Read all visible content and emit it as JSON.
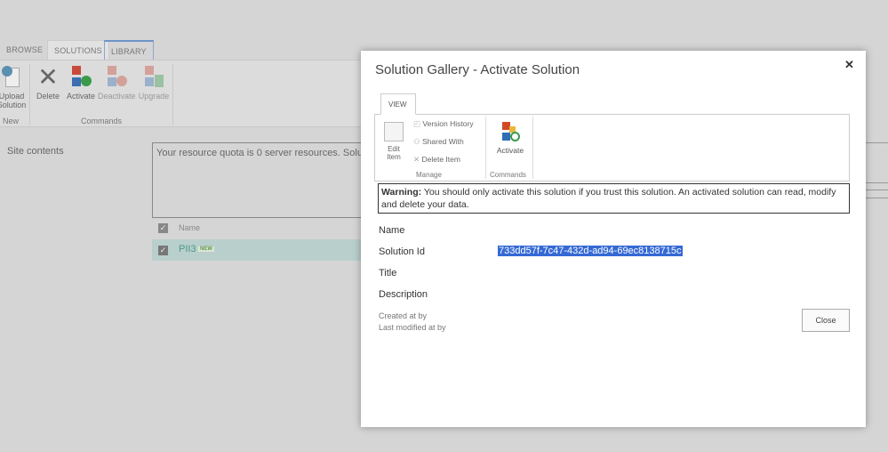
{
  "background": {
    "tabs": [
      "BROWSE",
      "SOLUTIONS",
      "LIBRARY"
    ],
    "ribbon": {
      "new_group": "New",
      "commands_group": "Commands",
      "buttons": [
        {
          "label": "Upload Solution",
          "icon": "upload-icon"
        },
        {
          "label": "Delete",
          "icon": "delete-icon"
        },
        {
          "label": "Activate",
          "icon": "activate-icon"
        },
        {
          "label": "Deactivate",
          "icon": "deactivate-icon"
        },
        {
          "label": "Upgrade",
          "icon": "upgrade-icon"
        }
      ]
    },
    "left_nav": "Site contents",
    "quota_text": "Your resource quota is 0 server resources. Solutio",
    "list": {
      "header": "Name",
      "rows": [
        {
          "name": "PII3",
          "badge": "NEW"
        }
      ]
    }
  },
  "modal": {
    "title": "Solution Gallery - Activate Solution",
    "close_icon": "close-icon",
    "tab": "VIEW",
    "manage": {
      "edit_item": "Edit Item",
      "version_history": "Version History",
      "shared_with": "Shared With",
      "delete_item": "Delete Item",
      "group": "Manage"
    },
    "commands": {
      "activate": "Activate",
      "group": "Commands"
    },
    "warning_bold": "Warning:",
    "warning_text": " You should only activate this solution if you trust this solution. An activated solution can read, modify and delete your data.",
    "fields": {
      "name": "Name",
      "solution_id_label": "Solution Id",
      "solution_id": "733dd57f-7c47-432d-ad94-69ec8138715c",
      "title": "Title",
      "description": "Description",
      "created": "Created at by",
      "modified": "Last modified at by"
    },
    "close_button": "Close"
  }
}
